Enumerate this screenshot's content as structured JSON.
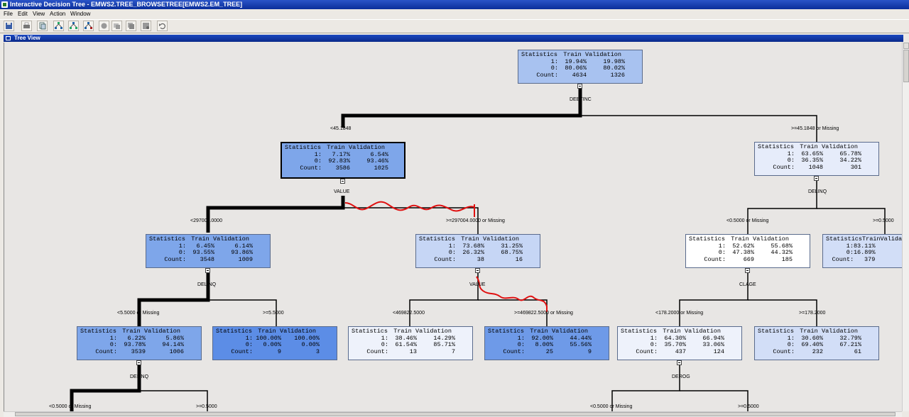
{
  "window": {
    "title": "Interactive Decision Tree - EMWS2.TREE_BROWSETREE[EMWS2.EM_TREE]"
  },
  "menu": [
    "File",
    "Edit",
    "View",
    "Action",
    "Window"
  ],
  "toolbar": {
    "buttons": [
      "save-icon",
      "print-icon",
      "copy-icon",
      "tree-view-icon",
      "split-node-icon",
      "prune-icon",
      "stop-icon",
      "train-icon",
      "copy-tree-icon",
      "results-icon",
      "undo-icon"
    ]
  },
  "panel": {
    "title": "Tree View"
  },
  "tree": {
    "header": [
      "Statistics",
      "Train",
      "Validation"
    ],
    "nodes": [
      {
        "id": "root",
        "rows": [
          [
            "1:",
            "19.94%",
            "19.98%"
          ],
          [
            "0:",
            "80.06%",
            "80.02%"
          ],
          [
            "Count:",
            "4634",
            "1326"
          ]
        ],
        "fill": "#a8c2f0"
      },
      {
        "id": "n_lt_debtinc",
        "rows": [
          [
            "1:",
            "7.17%",
            "6.54%"
          ],
          [
            "0:",
            "92.83%",
            "93.46%"
          ],
          [
            "Count:",
            "3586",
            "1025"
          ]
        ],
        "fill": "#7ea6ea"
      },
      {
        "id": "n_ge_debtinc",
        "rows": [
          [
            "1:",
            "63.65%",
            "65.78%"
          ],
          [
            "0:",
            "36.35%",
            "34.22%"
          ],
          [
            "Count:",
            "1048",
            "301"
          ]
        ],
        "fill": "#e6ecfa"
      },
      {
        "id": "n_lt_value",
        "rows": [
          [
            "1:",
            "6.45%",
            "6.14%"
          ],
          [
            "0:",
            "93.55%",
            "93.86%"
          ],
          [
            "Count:",
            "3548",
            "1009"
          ]
        ],
        "fill": "#7ea6ea"
      },
      {
        "id": "n_ge_value",
        "rows": [
          [
            "1:",
            "73.68%",
            "31.25%"
          ],
          [
            "0:",
            "26.32%",
            "68.75%"
          ],
          [
            "Count:",
            "38",
            "16"
          ]
        ],
        "fill": "#c6d6f5"
      },
      {
        "id": "n_delinq_lt",
        "rows": [
          [
            "1:",
            "52.62%",
            "55.68%"
          ],
          [
            "0:",
            "47.38%",
            "44.32%"
          ],
          [
            "Count:",
            "669",
            "185"
          ]
        ],
        "fill": "#ffffff"
      },
      {
        "id": "n_delinq_ge",
        "rows": [
          [
            "1:",
            "83.11%",
            ""
          ],
          [
            "0:",
            "16.89%",
            ""
          ],
          [
            "Count:",
            "379",
            ""
          ]
        ],
        "fill": "#d2def7"
      },
      {
        "id": "n_d1",
        "rows": [
          [
            "1:",
            "6.22%",
            "5.86%"
          ],
          [
            "0:",
            "93.78%",
            "94.14%"
          ],
          [
            "Count:",
            "3539",
            "1006"
          ]
        ],
        "fill": "#7ea6ea"
      },
      {
        "id": "n_d2",
        "rows": [
          [
            "1:",
            "100.00%",
            "100.00%"
          ],
          [
            "0:",
            "0.00%",
            "0.00%"
          ],
          [
            "Count:",
            "9",
            "3"
          ]
        ],
        "fill": "#5c8de6"
      },
      {
        "id": "n_v1",
        "rows": [
          [
            "1:",
            "38.46%",
            "14.29%"
          ],
          [
            "0:",
            "61.54%",
            "85.71%"
          ],
          [
            "Count:",
            "13",
            "7"
          ]
        ],
        "fill": "#eef2fb"
      },
      {
        "id": "n_v2",
        "rows": [
          [
            "1:",
            "92.00%",
            "44.44%"
          ],
          [
            "0:",
            "8.00%",
            "55.56%"
          ],
          [
            "Count:",
            "25",
            "9"
          ]
        ],
        "fill": "#6e9ae8"
      },
      {
        "id": "n_c1",
        "rows": [
          [
            "1:",
            "64.30%",
            "66.94%"
          ],
          [
            "0:",
            "35.70%",
            "33.06%"
          ],
          [
            "Count:",
            "437",
            "124"
          ]
        ],
        "fill": "#eef2fb"
      },
      {
        "id": "n_c2",
        "rows": [
          [
            "1:",
            "30.60%",
            "32.79%"
          ],
          [
            "0:",
            "69.40%",
            "67.21%"
          ],
          [
            "Count:",
            "232",
            "61"
          ]
        ],
        "fill": "#d2def7"
      }
    ],
    "split_vars": {
      "root": "DEBTINC",
      "n_lt_debtinc": "VALUE",
      "n_ge_debtinc": "DELINQ",
      "n_lt_value": "DELINQ",
      "n_ge_value": "VALUE",
      "n_delinq_lt": "CLAGE",
      "n_d1": "DELINQ",
      "n_c1": "DEROG"
    },
    "branch_labels": {
      "debtinc_lt": "<45.1848",
      "debtinc_ge": ">=45.1848 or Missing",
      "value_lt": "<297004.0000",
      "value_ge": ">=297004.0000 or Missing",
      "delinq_lt_a": "<0.5000 or Missing",
      "delinq_ge_a": ">=0.5000",
      "delinq_lt_b": "<5.5000 or Missing",
      "delinq_ge_b": ">=5.5000",
      "value2_lt": "<469822.5000",
      "value2_ge": ">=469822.5000 or Missing",
      "clage_lt": "<178.2000 or Missing",
      "clage_ge": ">=178.2000",
      "delinq3_lt": "<0.5000 or Missing",
      "delinq3_ge": ">=0.5000",
      "derog_lt": "<0.5000 or Missing",
      "derog_ge": ">=0.5000"
    }
  }
}
